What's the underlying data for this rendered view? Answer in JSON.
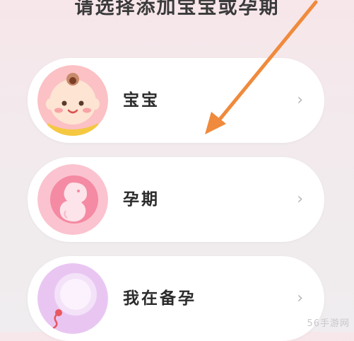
{
  "header": {
    "title": "请选择添加宝宝或孕期"
  },
  "options": [
    {
      "label": "宝宝",
      "icon": "baby-face-icon"
    },
    {
      "label": "孕期",
      "icon": "fetus-icon"
    },
    {
      "label": "我在备孕",
      "icon": "sperm-egg-icon"
    }
  ],
  "chevron": "›",
  "annotation": {
    "color": "#f08a3c"
  },
  "watermark": "56手游网"
}
